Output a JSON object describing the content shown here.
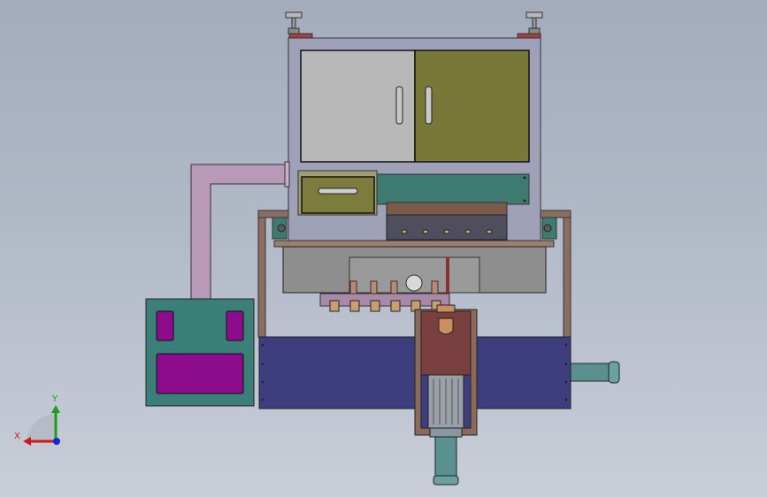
{
  "viewport": {
    "background_top": "#a3acbc",
    "background_bottom": "#c9ced8"
  },
  "triad": {
    "x_label": "X",
    "y_label": "Y",
    "x_color": "#d01818",
    "y_color": "#18a018",
    "z_color": "#1828d0"
  },
  "colors": {
    "frame": "#9ea1b8",
    "door_left": "#b8b8b8",
    "door_right": "#787838",
    "drawer": "#7c7c3c",
    "teal_panel": "#3e7a70",
    "duct": "#b89ab8",
    "filter_box": "#3a8078",
    "filter_opening": "#8c0c8c",
    "base": "#3e3e7e",
    "block": "#7a4040",
    "motor": "#9aa0a8",
    "outlet": "#5a9090"
  }
}
